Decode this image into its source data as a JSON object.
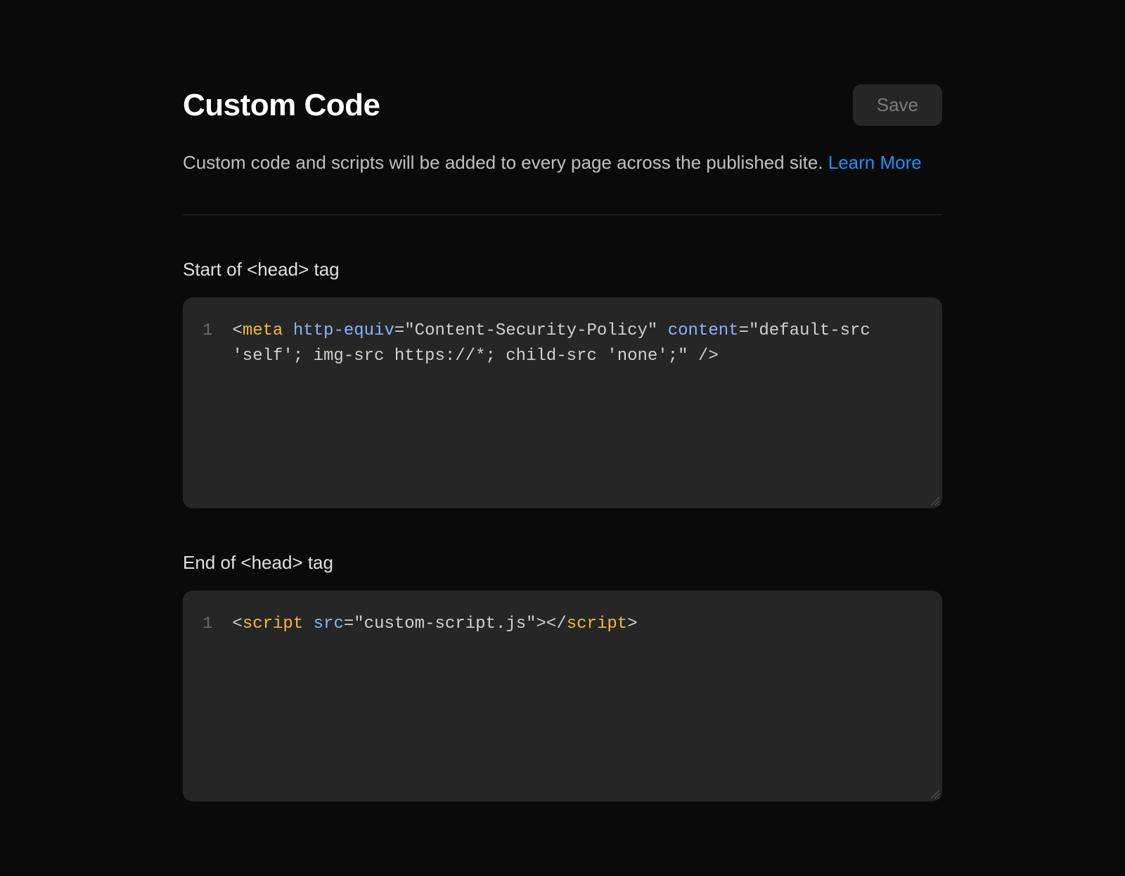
{
  "header": {
    "title": "Custom Code",
    "save_label": "Save"
  },
  "description": {
    "text": "Custom code and scripts will be added to every page across the published site. ",
    "link_text": "Learn More"
  },
  "sections": {
    "head_start": {
      "label": "Start of <head> tag",
      "line_number": "1",
      "code": "<meta http-equiv=\"Content-Security-Policy\" content=\"default-src 'self'; img-src https://*; child-src 'none';\" />",
      "tokens": [
        {
          "t": "punc",
          "v": "<"
        },
        {
          "t": "tag",
          "v": "meta"
        },
        {
          "t": "punc",
          "v": " "
        },
        {
          "t": "attr",
          "v": "http-equiv"
        },
        {
          "t": "punc",
          "v": "="
        },
        {
          "t": "str",
          "v": "\"Content-Security-Policy\""
        },
        {
          "t": "punc",
          "v": " "
        },
        {
          "t": "attr",
          "v": "content"
        },
        {
          "t": "punc",
          "v": "="
        },
        {
          "t": "str",
          "v": "\"default-src 'self'; img-src https://*; child-src 'none';\""
        },
        {
          "t": "punc",
          "v": " />"
        }
      ]
    },
    "head_end": {
      "label": "End of <head> tag",
      "line_number": "1",
      "code": "<script src=\"custom-script.js\"></script>",
      "tokens": [
        {
          "t": "punc",
          "v": "<"
        },
        {
          "t": "tag",
          "v": "script"
        },
        {
          "t": "punc",
          "v": " "
        },
        {
          "t": "attr",
          "v": "src"
        },
        {
          "t": "punc",
          "v": "="
        },
        {
          "t": "str",
          "v": "\"custom-script.js\""
        },
        {
          "t": "punc",
          "v": "></"
        },
        {
          "t": "tag",
          "v": "script"
        },
        {
          "t": "punc",
          "v": ">"
        }
      ]
    }
  },
  "colors": {
    "background": "#0a0a0a",
    "editor_bg": "#262626",
    "accent_link": "#1e90ff",
    "tag_color": "#f0b840",
    "attr_color": "#8ab4f8"
  }
}
